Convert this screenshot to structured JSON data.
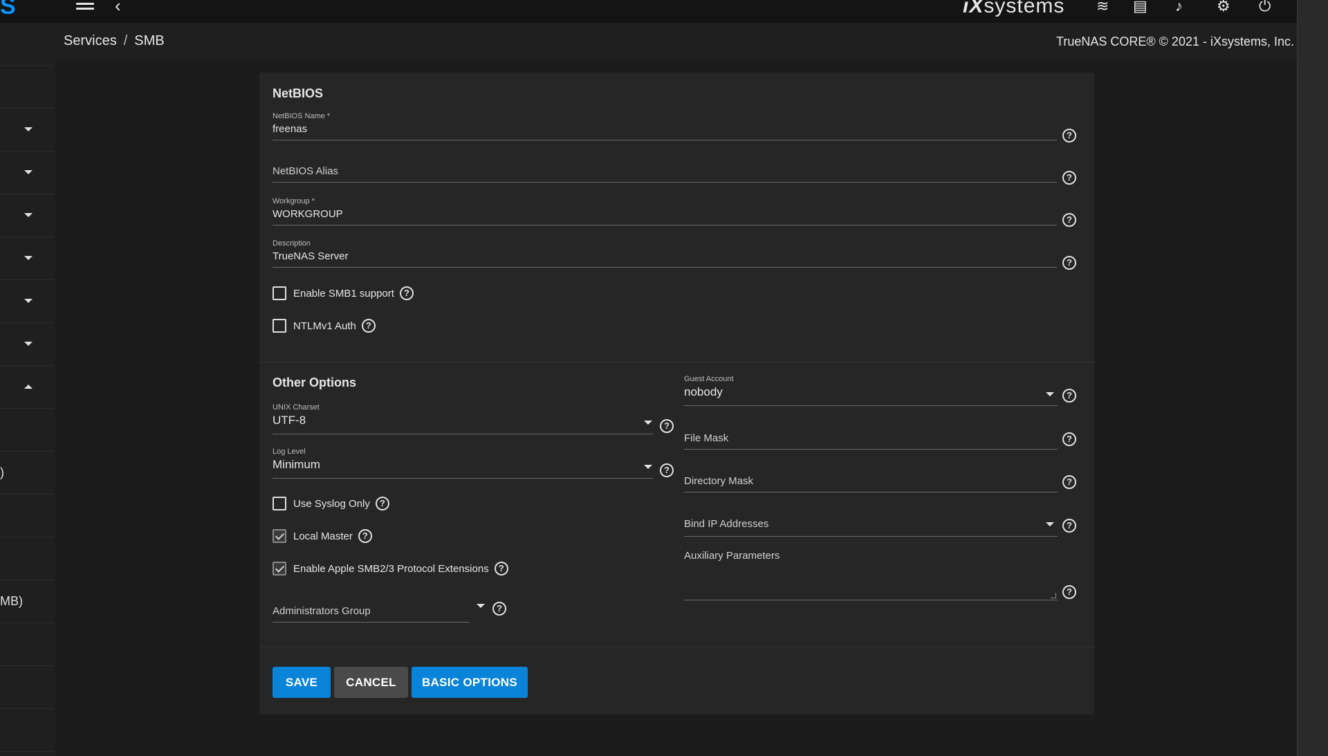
{
  "topbar": {
    "logo_fragment": "S",
    "brand": {
      "ix": "iX",
      "rest": "systems"
    },
    "icons": [
      "menu-icon",
      "back-icon",
      "layers-icon",
      "clipboard-icon",
      "bell-icon",
      "gear-icon",
      "power-icon"
    ]
  },
  "breadcrumb": {
    "items": [
      "Services",
      "SMB"
    ],
    "separator": "/"
  },
  "copyright": "TrueNAS CORE® © 2021 - iXsystems, Inc.",
  "sidebar": {
    "fragments": [
      ")",
      "MB)"
    ]
  },
  "netbios": {
    "title": "NetBIOS",
    "name": {
      "label": "NetBIOS Name *",
      "value": "freenas"
    },
    "alias": {
      "placeholder": "NetBIOS Alias"
    },
    "workgroup": {
      "label": "Workgroup *",
      "value": "WORKGROUP"
    },
    "description": {
      "label": "Description",
      "value": "TrueNAS Server"
    },
    "smb1": {
      "label": "Enable SMB1 support",
      "checked": false
    },
    "ntlmv1": {
      "label": "NTLMv1 Auth",
      "checked": false
    }
  },
  "other": {
    "title": "Other Options",
    "unix_charset": {
      "label": "UNIX Charset",
      "value": "UTF-8"
    },
    "log_level": {
      "label": "Log Level",
      "value": "Minimum"
    },
    "syslog_only": {
      "label": "Use Syslog Only",
      "checked": false
    },
    "local_master": {
      "label": "Local Master",
      "checked": true
    },
    "apple_ext": {
      "label": "Enable Apple SMB2/3 Protocol Extensions",
      "checked": true
    },
    "admin_group": {
      "placeholder": "Administrators Group"
    },
    "guest_account": {
      "label": "Guest Account",
      "value": "nobody"
    },
    "file_mask": {
      "placeholder": "File Mask"
    },
    "directory_mask": {
      "placeholder": "Directory Mask"
    },
    "bind_ip": {
      "placeholder": "Bind IP Addresses"
    },
    "aux_params": {
      "label": "Auxiliary Parameters"
    }
  },
  "buttons": {
    "save": "SAVE",
    "cancel": "CANCEL",
    "basic": "BASIC OPTIONS"
  },
  "help_glyph": "?"
}
